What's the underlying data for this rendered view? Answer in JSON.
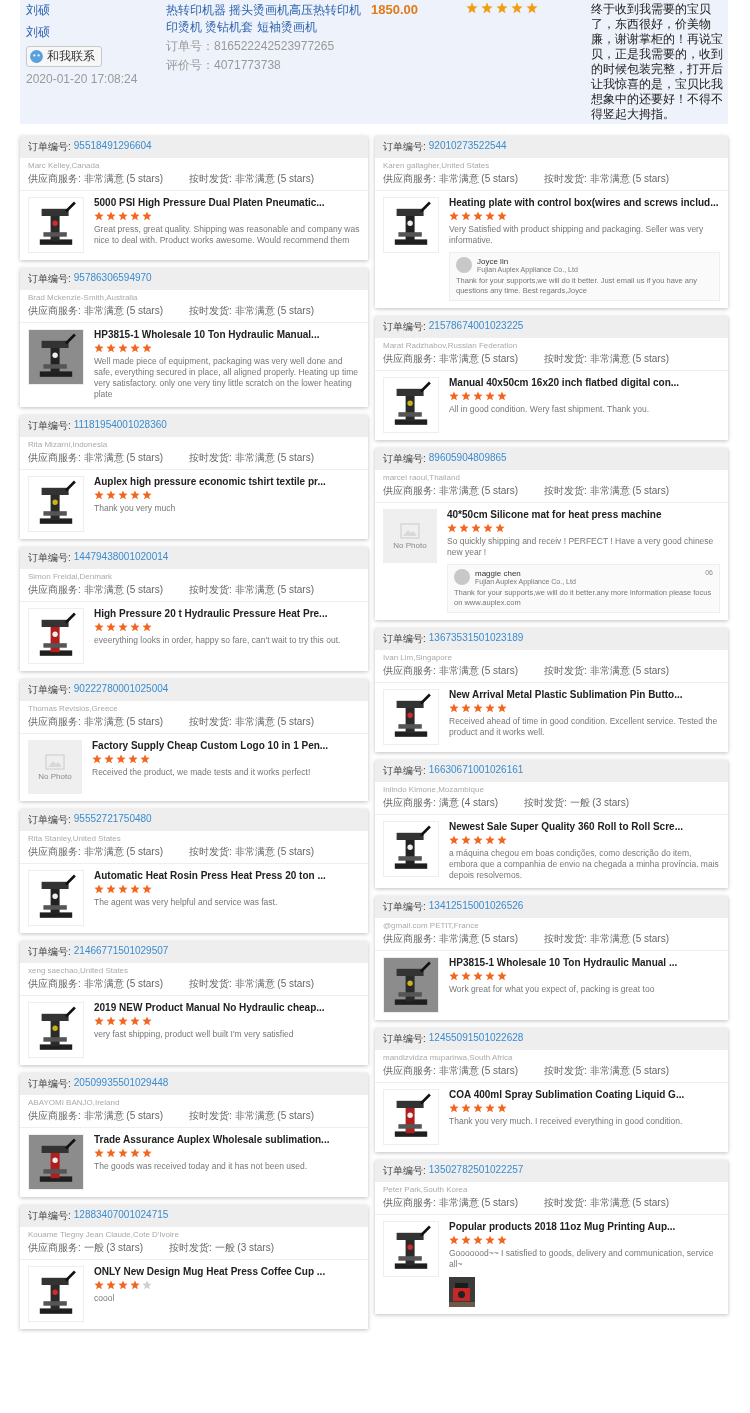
{
  "top_order": {
    "buyer": "刘硕",
    "buyer_link": "刘硕",
    "contact_button": "和我联系",
    "date": "2020-01-20 17:08:24",
    "product_title": "热转印机器 摇头烫画机高压热转印机印烫机 烫钻机套 短袖烫画机",
    "order_no": "订单号：816522242523977265",
    "review_no": "评价号：4071773738",
    "price": "1850.00",
    "stars": 5,
    "review": "终于收到我需要的宝贝了，东西很好，价美物廉，谢谢掌柜的！再说宝贝，正是我需要的，收到的时候包装完整，打开后让我惊喜的是，宝贝比我想象中的还要好！不得不得竖起大拇指。"
  },
  "left_column": [
    {
      "order_label": "订单编号:",
      "order_no": "95518491296604",
      "buyer": "Marc Kelley,Canada",
      "ratings": [
        "供应商服务: 非常满意 (5 stars)",
        "按时发货: 非常满意 (5 stars)"
      ],
      "product_title": "5000 PSI High Pressure Dual Platen Pneumatic...",
      "stars": 5,
      "review": "Great press, great quality. Shipping was reasonable and company was nice to deal with. Product works awesome. Would recommend them"
    },
    {
      "order_label": "订单编号:",
      "order_no": "95786306594970",
      "buyer": "Brad Mckenzie-Smith,Australia",
      "ratings": [
        "供应商服务: 非常满意 (5 stars)",
        "按时发货: 非常满意 (5 stars)"
      ],
      "product_title": "HP3815-1 Wholesale 10 Ton Hydraulic Manual...",
      "stars": 5,
      "review": "Well made piece of equipment, packaging was very well done and safe, everything secured in place, all aligned properly. Heating up time very satisfactory. only one very tiny little scratch on the lower heating plate"
    },
    {
      "order_label": "订单编号:",
      "order_no": "11181954001028360",
      "buyer": "Rita Mizarni,Indonesia",
      "ratings": [
        "供应商服务: 非常满意 (5 stars)",
        "按时发货: 非常满意 (5 stars)"
      ],
      "product_title": "Auplex high pressure economic tshirt textile pr...",
      "stars": 5,
      "review": "Thank you very much"
    },
    {
      "order_label": "订单编号:",
      "order_no": "14479438001020014",
      "buyer": "Simon Freidal,Denmark",
      "ratings": [
        "供应商服务: 非常满意 (5 stars)",
        "按时发货: 非常满意 (5 stars)"
      ],
      "product_title": "High Pressure 20 t Hydraulic Pressure Heat Pre...",
      "stars": 5,
      "review": "eveerything looks in order, happy so fare, can't wait to try this out."
    },
    {
      "order_label": "订单编号:",
      "order_no": "90222780001025004",
      "buyer": "Thomas Revisios,Greece",
      "ratings": [
        "供应商服务: 非常满意 (5 stars)",
        "按时发货: 非常满意 (5 stars)"
      ],
      "product_title": "Factory Supply Cheap Custom Logo 10 in 1 Pen...",
      "stars": 5,
      "review": "Received the product, we made tests and it works perfect!",
      "image": {
        "kind": "no-photo",
        "label": "No Photo"
      }
    },
    {
      "order_label": "订单编号:",
      "order_no": "95552721750480",
      "buyer": "Rita Stanley,United States",
      "ratings": [
        "供应商服务: 非常满意 (5 stars)",
        "按时发货: 非常满意 (5 stars)"
      ],
      "product_title": "Automatic Heat Rosin Press Heat Press 20 ton ...",
      "stars": 5,
      "review": "The agent was very helpful and service was fast."
    },
    {
      "order_label": "订单编号:",
      "order_no": "21466771501029507",
      "buyer": "xeng saechao,United States",
      "ratings": [
        "供应商服务: 非常满意 (5 stars)",
        "按时发货: 非常满意 (5 stars)"
      ],
      "product_title": "2019 NEW Product Manual No Hydraulic cheap...",
      "stars": 5,
      "review": "very fast shipping, product well built I'm very satisfied"
    },
    {
      "order_label": "订单编号:",
      "order_no": "20509935501029448",
      "buyer": "ABAYOMI BANJO,Ireland",
      "ratings": [
        "供应商服务: 非常满意 (5 stars)",
        "按时发货: 非常满意 (5 stars)"
      ],
      "product_title": "Trade Assurance Auplex Wholesale sublimation...",
      "stars": 5,
      "review": "The goods was received today and it has not been used."
    },
    {
      "order_label": "订单编号:",
      "order_no": "12883407001024715",
      "buyer": "Kouame Tiegny Jean Claude,Cote D'Ivoire",
      "ratings": [
        "供应商服务: 一般 (3 stars)",
        "按时发货: 一般 (3 stars)"
      ],
      "product_title": "ONLY New Design Mug Heat Press Coffee Cup ...",
      "stars": 4,
      "review": "coool"
    }
  ],
  "right_column": [
    {
      "order_label": "订单编号:",
      "order_no": "92010273522544",
      "buyer": "Karen gallagher,United States",
      "ratings": [
        "供应商服务: 非常满意 (5 stars)",
        "按时发货: 非常满意 (5 stars)"
      ],
      "product_title": "Heating plate with control box(wires and screws includ...",
      "stars": 5,
      "review": "Very Satisfied with product shipping and packaging. Seller was very informative.",
      "reply": {
        "name": "Joyce lin",
        "company": "Fujian Auplex Appliance Co., Ltd",
        "text": "Thank for your supports,we will do it better. Just email us if you have any questions any time. Best regards,Joyce"
      }
    },
    {
      "order_label": "订单编号:",
      "order_no": "21578674001023225",
      "buyer": "Marat Radzhabov,Russian Federation",
      "ratings": [
        "供应商服务: 非常满意 (5 stars)",
        "按时发货: 非常满意 (5 stars)"
      ],
      "product_title": "Manual 40x50cm 16x20 inch flatbed digital con...",
      "stars": 5,
      "review": "All in good condition. Wery fast shipment. Thank you."
    },
    {
      "order_label": "订单编号:",
      "order_no": "89605904809865",
      "buyer": "marcel raoul,Thailand",
      "ratings": [
        "供应商服务: 非常满意 (5 stars)",
        "按时发货: 非常满意 (5 stars)"
      ],
      "product_title": "40*50cm Silicone mat for heat press machine",
      "stars": 5,
      "review": "So quickly shipping and receiv ! PERFECT ! Have a very good chinese new year !",
      "image": {
        "kind": "no-photo",
        "label": "No Photo"
      },
      "reply": {
        "name": "maggie chen",
        "company": "Fujian Auplex Appliance Co., Ltd",
        "date": "06",
        "text": "Thank for your supports,we will do it better.any more information please focus on www.auplex.com"
      }
    },
    {
      "order_label": "订单编号:",
      "order_no": "13673531501023189",
      "buyer": "Ivan Lim,Singapore",
      "ratings": [
        "供应商服务: 非常满意 (5 stars)",
        "按时发货: 非常满意 (5 stars)"
      ],
      "product_title": "New Arrival Metal Plastic Sublimation Pin Butto...",
      "stars": 5,
      "review": "Received ahead of time in good condition. Excellent service. Tested the product and it works well."
    },
    {
      "order_label": "订单编号:",
      "order_no": "16630671001026161",
      "buyer": "Inlindo Kimone,Mozambique",
      "ratings": [
        "供应商服务: 满意 (4 stars)",
        "按时发货: 一般 (3 stars)"
      ],
      "product_title": "Newest Sale Super Quality 360 Roll to Roll Scre...",
      "stars": 5,
      "review": "a máquina chegou em boas condições, como descrição do item, embora que a companhia de envio na chegada a minha província. mais depois resolvemos."
    },
    {
      "order_label": "订单编号:",
      "order_no": "13412515001026526",
      "buyer": "@gmail.com PETIT,France",
      "ratings": [
        "供应商服务: 非常满意 (5 stars)",
        "按时发货: 非常满意 (5 stars)"
      ],
      "product_title": "HP3815-1 Wholesale 10 Ton Hydraulic Manual ...",
      "stars": 5,
      "review": "Work great for what you expect of, packing is great too"
    },
    {
      "order_label": "订单编号:",
      "order_no": "12455091501022628",
      "buyer": "mandizvidza muparirwa,South Africa",
      "ratings": [
        "供应商服务: 非常满意 (5 stars)",
        "按时发货: 非常满意 (5 stars)"
      ],
      "product_title": "COA 400ml Spray Sublimation Coating Liquid G...",
      "stars": 5,
      "review": "Thank you very much. I received everything in good condition."
    },
    {
      "order_label": "订单编号:",
      "order_no": "13502782501022257",
      "buyer": "Peter Park,South Korea",
      "ratings": [
        "供应商服务: 非常满意 (5 stars)",
        "按时发货: 非常满意 (5 stars)"
      ],
      "product_title": "Popular products 2018 11oz Mug Printing Aup...",
      "stars": 5,
      "review": "Gooooood~~ I satisfied to goods, delivery and communication, service all~"
    }
  ]
}
